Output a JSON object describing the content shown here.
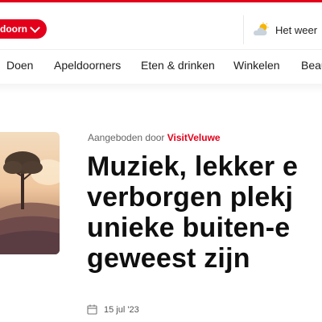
{
  "header": {
    "city_label": "doorn",
    "weather_label": "Het weer"
  },
  "nav": {
    "items": [
      "Doen",
      "Apeldoorners",
      "Eten & drinken",
      "Winkelen",
      "Beau"
    ]
  },
  "article": {
    "sponsored_prefix": "Aangeboden door",
    "sponsor": "VisitVeluwe",
    "title_lines": [
      "Muziek, lekker e",
      "verborgen plekj",
      "unieke buiten-e",
      "geweest zijn"
    ],
    "date": "15 jul '23"
  },
  "colors": {
    "brand_red": "#e3001b"
  }
}
